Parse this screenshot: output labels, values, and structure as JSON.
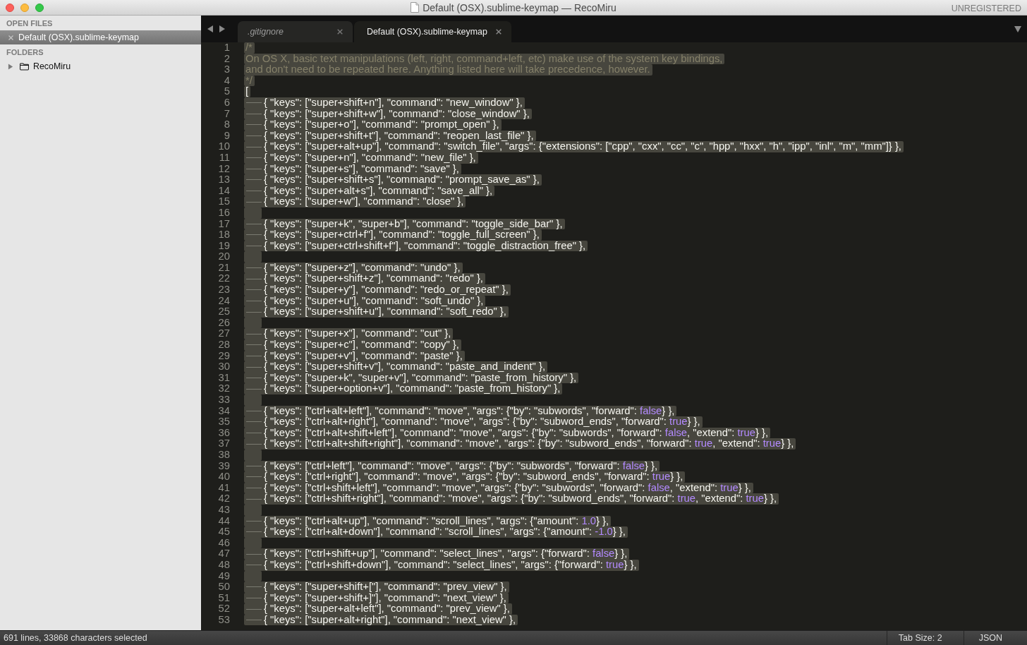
{
  "window": {
    "title": "Default (OSX).sublime-keymap — RecoMiru",
    "registration": "UNREGISTERED"
  },
  "sidebar": {
    "open_files": {
      "title": "OPEN FILES",
      "items": [
        {
          "label": "Default (OSX).sublime-keymap",
          "selected": true
        }
      ]
    },
    "folders": {
      "title": "FOLDERS",
      "items": [
        {
          "label": "RecoMiru",
          "expanded": false
        }
      ]
    }
  },
  "tabs": [
    {
      "label": ".gitignore",
      "selected": false,
      "preview": true
    },
    {
      "label": "Default (OSX).sublime-keymap",
      "selected": true,
      "preview": false
    }
  ],
  "editor": {
    "lines": [
      {
        "number": "1",
        "selected": true,
        "tab": false,
        "segments": [
          {
            "kind": "comment",
            "text": "/*"
          }
        ]
      },
      {
        "number": "2",
        "selected": true,
        "tab": false,
        "segments": [
          {
            "kind": "comment",
            "text": "On OS X, basic text manipulations (left, right, command+left, etc) make use of the system key bindings,"
          }
        ]
      },
      {
        "number": "3",
        "selected": true,
        "tab": false,
        "segments": [
          {
            "kind": "comment",
            "text": "and don't need to be repeated here. Anything listed here will take precedence, however."
          }
        ]
      },
      {
        "number": "4",
        "selected": true,
        "tab": false,
        "segments": [
          {
            "kind": "comment",
            "text": "*/"
          }
        ]
      },
      {
        "number": "5",
        "selected": true,
        "tab": false,
        "segments": [
          {
            "kind": "code",
            "text": "["
          }
        ]
      },
      {
        "number": "6",
        "selected": true,
        "tab": true,
        "segments": [
          {
            "kind": "code",
            "text": "{ \"keys\": [\"super+shift+n\"], \"command\": \"new_window\" },"
          }
        ]
      },
      {
        "number": "7",
        "selected": true,
        "tab": true,
        "segments": [
          {
            "kind": "code",
            "text": "{ \"keys\": [\"super+shift+w\"], \"command\": \"close_window\" },"
          }
        ]
      },
      {
        "number": "8",
        "selected": true,
        "tab": true,
        "segments": [
          {
            "kind": "code",
            "text": "{ \"keys\": [\"super+o\"], \"command\": \"prompt_open\" },"
          }
        ]
      },
      {
        "number": "9",
        "selected": true,
        "tab": true,
        "segments": [
          {
            "kind": "code",
            "text": "{ \"keys\": [\"super+shift+t\"], \"command\": \"reopen_last_file\" },"
          }
        ]
      },
      {
        "number": "10",
        "selected": true,
        "tab": true,
        "segments": [
          {
            "kind": "code",
            "text": "{ \"keys\": [\"super+alt+up\"], \"command\": \"switch_file\", \"args\": {\"extensions\": [\"cpp\", \"cxx\", \"cc\", \"c\", \"hpp\", \"hxx\", \"h\", \"ipp\", \"inl\", \"m\", \"mm\"]} },"
          }
        ]
      },
      {
        "number": "11",
        "selected": true,
        "tab": true,
        "segments": [
          {
            "kind": "code",
            "text": "{ \"keys\": [\"super+n\"], \"command\": \"new_file\" },"
          }
        ]
      },
      {
        "number": "12",
        "selected": true,
        "tab": true,
        "segments": [
          {
            "kind": "code",
            "text": "{ \"keys\": [\"super+s\"], \"command\": \"save\" },"
          }
        ]
      },
      {
        "number": "13",
        "selected": true,
        "tab": true,
        "segments": [
          {
            "kind": "code",
            "text": "{ \"keys\": [\"super+shift+s\"], \"command\": \"prompt_save_as\" },"
          }
        ]
      },
      {
        "number": "14",
        "selected": true,
        "tab": true,
        "segments": [
          {
            "kind": "code",
            "text": "{ \"keys\": [\"super+alt+s\"], \"command\": \"save_all\" },"
          }
        ]
      },
      {
        "number": "15",
        "selected": true,
        "tab": true,
        "segments": [
          {
            "kind": "code",
            "text": "{ \"keys\": [\"super+w\"], \"command\": \"close\" },"
          }
        ]
      },
      {
        "number": "16",
        "selected": true,
        "tab": false
      },
      {
        "number": "17",
        "selected": true,
        "tab": true,
        "segments": [
          {
            "kind": "code",
            "text": "{ \"keys\": [\"super+k\", \"super+b\"], \"command\": \"toggle_side_bar\" },"
          }
        ]
      },
      {
        "number": "18",
        "selected": true,
        "tab": true,
        "segments": [
          {
            "kind": "code",
            "text": "{ \"keys\": [\"super+ctrl+f\"], \"command\": \"toggle_full_screen\" },"
          }
        ]
      },
      {
        "number": "19",
        "selected": true,
        "tab": true,
        "segments": [
          {
            "kind": "code",
            "text": "{ \"keys\": [\"super+ctrl+shift+f\"], \"command\": \"toggle_distraction_free\" },"
          }
        ]
      },
      {
        "number": "20",
        "selected": true,
        "tab": false
      },
      {
        "number": "21",
        "selected": true,
        "tab": true,
        "segments": [
          {
            "kind": "code",
            "text": "{ \"keys\": [\"super+z\"], \"command\": \"undo\" },"
          }
        ]
      },
      {
        "number": "22",
        "selected": true,
        "tab": true,
        "segments": [
          {
            "kind": "code",
            "text": "{ \"keys\": [\"super+shift+z\"], \"command\": \"redo\" },"
          }
        ]
      },
      {
        "number": "23",
        "selected": true,
        "tab": true,
        "segments": [
          {
            "kind": "code",
            "text": "{ \"keys\": [\"super+y\"], \"command\": \"redo_or_repeat\" },"
          }
        ]
      },
      {
        "number": "24",
        "selected": true,
        "tab": true,
        "segments": [
          {
            "kind": "code",
            "text": "{ \"keys\": [\"super+u\"], \"command\": \"soft_undo\" },"
          }
        ]
      },
      {
        "number": "25",
        "selected": true,
        "tab": true,
        "segments": [
          {
            "kind": "code",
            "text": "{ \"keys\": [\"super+shift+u\"], \"command\": \"soft_redo\" },"
          }
        ]
      },
      {
        "number": "26",
        "selected": true,
        "tab": false
      },
      {
        "number": "27",
        "selected": true,
        "tab": true,
        "segments": [
          {
            "kind": "code",
            "text": "{ \"keys\": [\"super+x\"], \"command\": \"cut\" },"
          }
        ]
      },
      {
        "number": "28",
        "selected": true,
        "tab": true,
        "segments": [
          {
            "kind": "code",
            "text": "{ \"keys\": [\"super+c\"], \"command\": \"copy\" },"
          }
        ]
      },
      {
        "number": "29",
        "selected": true,
        "tab": true,
        "segments": [
          {
            "kind": "code",
            "text": "{ \"keys\": [\"super+v\"], \"command\": \"paste\" },"
          }
        ]
      },
      {
        "number": "30",
        "selected": true,
        "tab": true,
        "segments": [
          {
            "kind": "code",
            "text": "{ \"keys\": [\"super+shift+v\"], \"command\": \"paste_and_indent\" },"
          }
        ]
      },
      {
        "number": "31",
        "selected": true,
        "tab": true,
        "segments": [
          {
            "kind": "code",
            "text": "{ \"keys\": [\"super+k\", \"super+v\"], \"command\": \"paste_from_history\" },"
          }
        ]
      },
      {
        "number": "32",
        "selected": true,
        "tab": true,
        "segments": [
          {
            "kind": "code",
            "text": "{ \"keys\": [\"super+option+v\"], \"command\": \"paste_from_history\" },"
          }
        ]
      },
      {
        "number": "33",
        "selected": true,
        "tab": false
      },
      {
        "number": "34",
        "selected": true,
        "tab": true,
        "segments": [
          {
            "kind": "code",
            "text": "{ \"keys\": [\"ctrl+alt+left\"], \"command\": \"move\", \"args\": {\"by\": \"subwords\", \"forward\": "
          },
          {
            "kind": "literal",
            "text": "false"
          },
          {
            "kind": "code",
            "text": "} },"
          }
        ]
      },
      {
        "number": "35",
        "selected": true,
        "tab": true,
        "segments": [
          {
            "kind": "code",
            "text": "{ \"keys\": [\"ctrl+alt+right\"], \"command\": \"move\", \"args\": {\"by\": \"subword_ends\", \"forward\": "
          },
          {
            "kind": "literal",
            "text": "true"
          },
          {
            "kind": "code",
            "text": "} },"
          }
        ]
      },
      {
        "number": "36",
        "selected": true,
        "tab": true,
        "segments": [
          {
            "kind": "code",
            "text": "{ \"keys\": [\"ctrl+alt+shift+left\"], \"command\": \"move\", \"args\": {\"by\": \"subwords\", \"forward\": "
          },
          {
            "kind": "literal",
            "text": "false"
          },
          {
            "kind": "code",
            "text": ", \"extend\": "
          },
          {
            "kind": "literal",
            "text": "true"
          },
          {
            "kind": "code",
            "text": "} },"
          }
        ]
      },
      {
        "number": "37",
        "selected": true,
        "tab": true,
        "segments": [
          {
            "kind": "code",
            "text": "{ \"keys\": [\"ctrl+alt+shift+right\"], \"command\": \"move\", \"args\": {\"by\": \"subword_ends\", \"forward\": "
          },
          {
            "kind": "literal",
            "text": "true"
          },
          {
            "kind": "code",
            "text": ", \"extend\": "
          },
          {
            "kind": "literal",
            "text": "true"
          },
          {
            "kind": "code",
            "text": "} },"
          }
        ]
      },
      {
        "number": "38",
        "selected": true,
        "tab": false
      },
      {
        "number": "39",
        "selected": true,
        "tab": true,
        "segments": [
          {
            "kind": "code",
            "text": "{ \"keys\": [\"ctrl+left\"], \"command\": \"move\", \"args\": {\"by\": \"subwords\", \"forward\": "
          },
          {
            "kind": "literal",
            "text": "false"
          },
          {
            "kind": "code",
            "text": "} },"
          }
        ]
      },
      {
        "number": "40",
        "selected": true,
        "tab": true,
        "segments": [
          {
            "kind": "code",
            "text": "{ \"keys\": [\"ctrl+right\"], \"command\": \"move\", \"args\": {\"by\": \"subword_ends\", \"forward\": "
          },
          {
            "kind": "literal",
            "text": "true"
          },
          {
            "kind": "code",
            "text": "} },"
          }
        ]
      },
      {
        "number": "41",
        "selected": true,
        "tab": true,
        "segments": [
          {
            "kind": "code",
            "text": "{ \"keys\": [\"ctrl+shift+left\"], \"command\": \"move\", \"args\": {\"by\": \"subwords\", \"forward\": "
          },
          {
            "kind": "literal",
            "text": "false"
          },
          {
            "kind": "code",
            "text": ", \"extend\": "
          },
          {
            "kind": "literal",
            "text": "true"
          },
          {
            "kind": "code",
            "text": "} },"
          }
        ]
      },
      {
        "number": "42",
        "selected": true,
        "tab": true,
        "segments": [
          {
            "kind": "code",
            "text": "{ \"keys\": [\"ctrl+shift+right\"], \"command\": \"move\", \"args\": {\"by\": \"subword_ends\", \"forward\": "
          },
          {
            "kind": "literal",
            "text": "true"
          },
          {
            "kind": "code",
            "text": ", \"extend\": "
          },
          {
            "kind": "literal",
            "text": "true"
          },
          {
            "kind": "code",
            "text": "} },"
          }
        ]
      },
      {
        "number": "43",
        "selected": true,
        "tab": false
      },
      {
        "number": "44",
        "selected": true,
        "tab": true,
        "segments": [
          {
            "kind": "code",
            "text": "{ \"keys\": [\"ctrl+alt+up\"], \"command\": \"scroll_lines\", \"args\": {\"amount\": "
          },
          {
            "kind": "literal",
            "text": "1.0"
          },
          {
            "kind": "code",
            "text": "} },"
          }
        ]
      },
      {
        "number": "45",
        "selected": true,
        "tab": true,
        "segments": [
          {
            "kind": "code",
            "text": "{ \"keys\": [\"ctrl+alt+down\"], \"command\": \"scroll_lines\", \"args\": {\"amount\": "
          },
          {
            "kind": "literal",
            "text": "-1.0"
          },
          {
            "kind": "code",
            "text": "} },"
          }
        ]
      },
      {
        "number": "46",
        "selected": true,
        "tab": false
      },
      {
        "number": "47",
        "selected": true,
        "tab": true,
        "segments": [
          {
            "kind": "code",
            "text": "{ \"keys\": [\"ctrl+shift+up\"], \"command\": \"select_lines\", \"args\": {\"forward\": "
          },
          {
            "kind": "literal",
            "text": "false"
          },
          {
            "kind": "code",
            "text": "} },"
          }
        ]
      },
      {
        "number": "48",
        "selected": true,
        "tab": true,
        "segments": [
          {
            "kind": "code",
            "text": "{ \"keys\": [\"ctrl+shift+down\"], \"command\": \"select_lines\", \"args\": {\"forward\": "
          },
          {
            "kind": "literal",
            "text": "true"
          },
          {
            "kind": "code",
            "text": "} },"
          }
        ]
      },
      {
        "number": "49",
        "selected": true,
        "tab": false
      },
      {
        "number": "50",
        "selected": true,
        "tab": true,
        "segments": [
          {
            "kind": "code",
            "text": "{ \"keys\": [\"super+shift+[\"], \"command\": \"prev_view\" },"
          }
        ]
      },
      {
        "number": "51",
        "selected": true,
        "tab": true,
        "segments": [
          {
            "kind": "code",
            "text": "{ \"keys\": [\"super+shift+]\"], \"command\": \"next_view\" },"
          }
        ]
      },
      {
        "number": "52",
        "selected": true,
        "tab": true,
        "segments": [
          {
            "kind": "code",
            "text": "{ \"keys\": [\"super+alt+left\"], \"command\": \"prev_view\" },"
          }
        ]
      },
      {
        "number": "53",
        "selected": true,
        "tab": true,
        "segments": [
          {
            "kind": "code",
            "text": "{ \"keys\": [\"super+alt+right\"], \"command\": \"next_view\" },"
          }
        ]
      }
    ]
  },
  "status_bar": {
    "message": "691 lines, 33868 characters selected",
    "tab_size": "Tab Size: 2",
    "syntax": "JSON"
  }
}
